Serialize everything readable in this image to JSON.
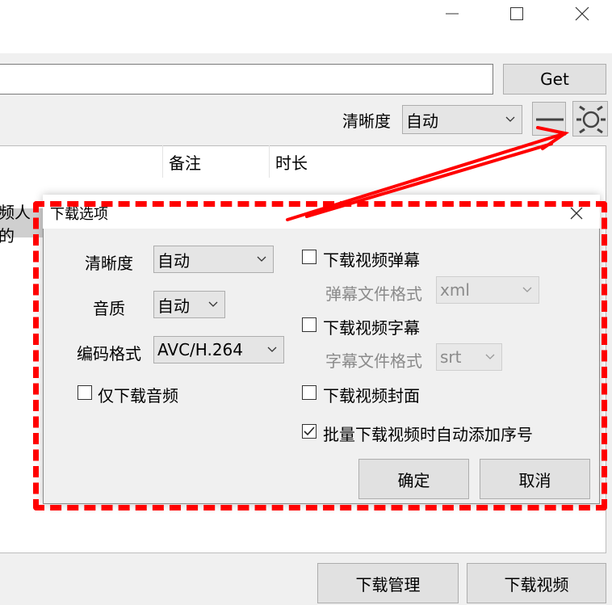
{
  "window": {
    "minimize_icon": "minimize-icon",
    "maximize_icon": "maximize-icon",
    "close_icon": "close-icon"
  },
  "toolbar": {
    "get_label": "Get",
    "quality_label": "清晰度",
    "quality_value": "自动",
    "menu_icon": "hamburger-icon",
    "settings_icon": "gear-icon"
  },
  "table": {
    "columns": [
      "备注",
      "时长"
    ],
    "partial_row_text": "频人的"
  },
  "footer": {
    "download_manager_label": "下载管理",
    "download_video_label": "下载视频"
  },
  "dialog": {
    "title": "下载选项",
    "quality_label": "清晰度",
    "quality_value": "自动",
    "audio_label": "音质",
    "audio_value": "自动",
    "codec_label": "编码格式",
    "codec_value": "AVC/H.264",
    "audio_only_label": "仅下载音频",
    "audio_only_checked": false,
    "danmaku_label": "下载视频弹幕",
    "danmaku_checked": false,
    "danmaku_format_label": "弹幕文件格式",
    "danmaku_format_value": "xml",
    "subtitle_label": "下载视频字幕",
    "subtitle_checked": false,
    "subtitle_format_label": "字幕文件格式",
    "subtitle_format_value": "srt",
    "cover_label": "下载视频封面",
    "cover_checked": false,
    "batch_number_label": "批量下载视频时自动添加序号",
    "batch_number_checked": true,
    "ok_label": "确定",
    "cancel_label": "取消"
  },
  "annotation": {
    "color": "#ff0000"
  }
}
